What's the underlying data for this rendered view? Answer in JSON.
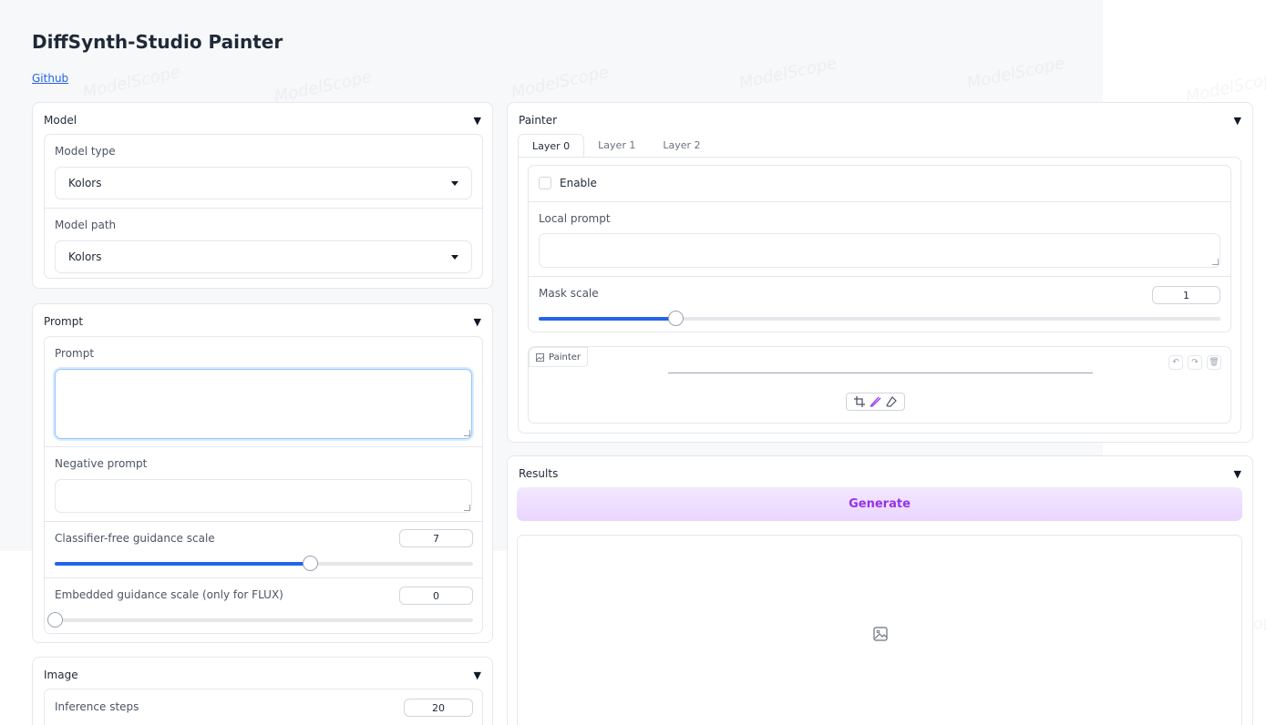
{
  "app": {
    "title": "DiffSynth-Studio Painter",
    "link": "Github"
  },
  "watermark": "ModelScope",
  "model": {
    "title": "Model",
    "type_label": "Model type",
    "type_value": "Kolors",
    "path_label": "Model path",
    "path_value": "Kolors"
  },
  "prompt": {
    "title": "Prompt",
    "prompt_label": "Prompt",
    "prompt_value": "",
    "neg_label": "Negative prompt",
    "neg_value": "",
    "cfg_label": "Classifier-free guidance scale",
    "cfg_value": "7",
    "cfg_fraction": 0.61,
    "emb_label": "Embedded guidance scale (only for FLUX)",
    "emb_value": "0",
    "emb_fraction": 0.0
  },
  "image": {
    "title": "Image",
    "steps_label": "Inference steps",
    "steps_value": "20"
  },
  "painter": {
    "title": "Painter",
    "tabs": [
      "Layer 0",
      "Layer 1",
      "Layer 2"
    ],
    "active_tab": 0,
    "enable_label": "Enable",
    "local_prompt_label": "Local prompt",
    "local_prompt_value": "",
    "mask_scale_label": "Mask scale",
    "mask_scale_value": "1",
    "mask_fraction": 0.2,
    "canvas_label": "Painter",
    "icons": [
      "undo-icon",
      "redo-icon",
      "trash-icon",
      "crop-icon",
      "brush-icon",
      "eraser-icon"
    ]
  },
  "results": {
    "title": "Results",
    "generate_label": "Generate",
    "icons": [
      "image-icon"
    ]
  },
  "colors": {
    "accent": "#2563eb",
    "generate_text": "#9333ea",
    "generate_bg": "#ede0ff"
  }
}
